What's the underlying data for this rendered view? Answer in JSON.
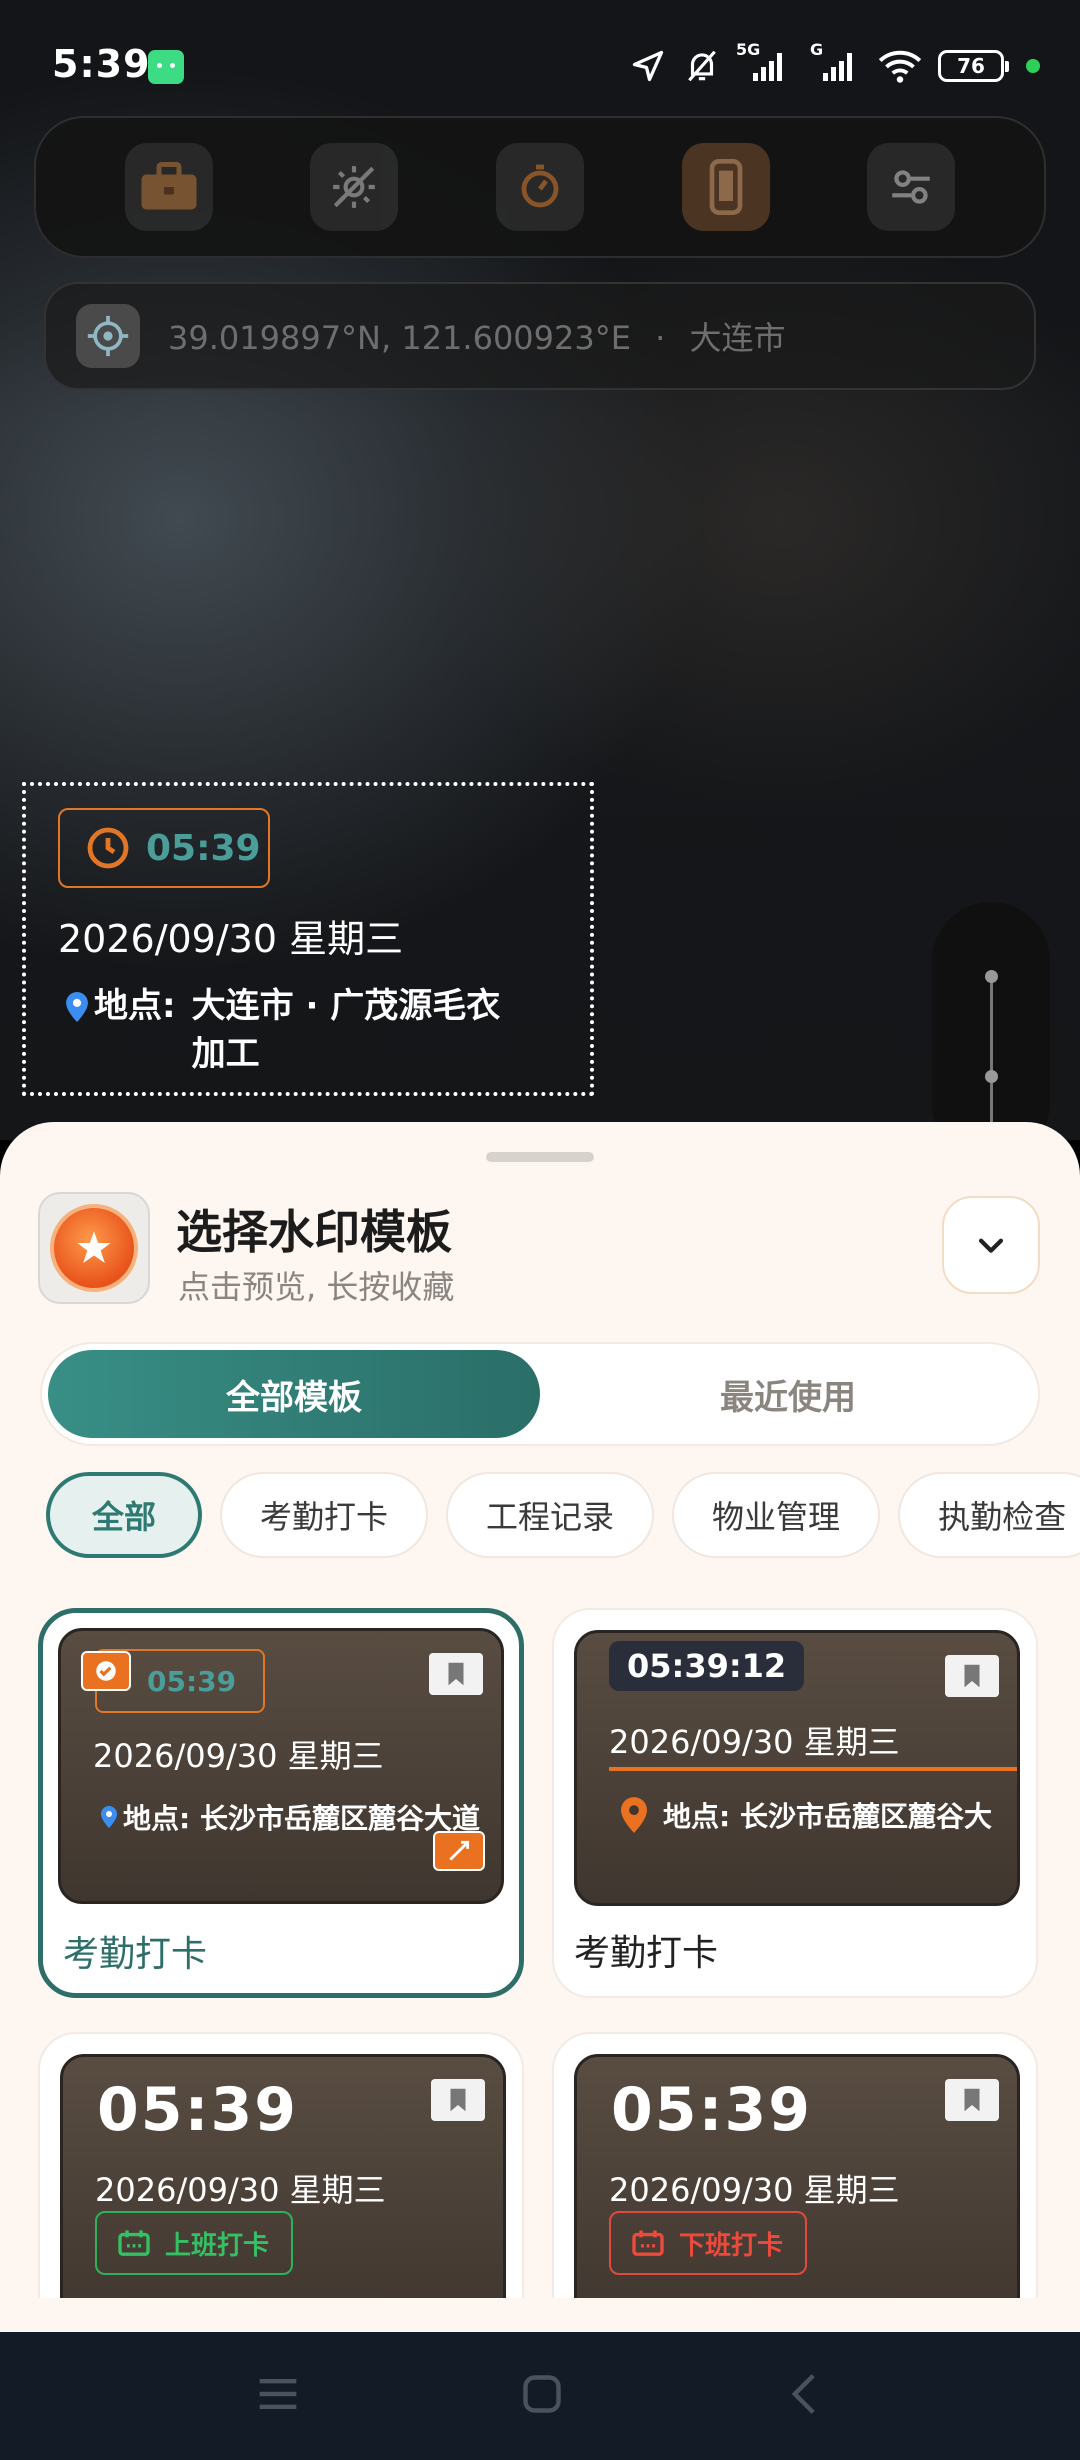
{
  "status_bar": {
    "time": "5:39",
    "network_label_1": "5G",
    "network_label_2": "G",
    "battery": "76",
    "icons": [
      "android-icon",
      "location-arrow-icon",
      "mute-bell-icon",
      "signal-5g-icon",
      "signal-icon",
      "wifi-icon",
      "battery-icon",
      "privacy-dot-icon"
    ]
  },
  "toolbar": {
    "items": [
      "briefcase-icon",
      "flash-off-icon",
      "timer-icon",
      "phone-frame-icon",
      "camera-settings-icon"
    ]
  },
  "location_bar": {
    "coords": "39.019897°N, 121.600923°E",
    "separator": "·",
    "city": "大连市"
  },
  "watermark_preview": {
    "time": "05:39",
    "date": "2026/09/30 星期三",
    "location_prefix": "地点:",
    "location_line1": "大连市 · 广茂源毛衣",
    "location_line2": "加工"
  },
  "sheet": {
    "title": "选择水印模板",
    "subtitle": "点击预览, 长按收藏",
    "segments": [
      "全部模板",
      "最近使用"
    ],
    "active_segment": "全部模板",
    "categories": [
      "全部",
      "考勤打卡",
      "工程记录",
      "物业管理",
      "执勤检查"
    ],
    "active_category": "全部",
    "templates": [
      {
        "label": "考勤打卡",
        "time": "05:39",
        "date": "2026/09/30 星期三",
        "location": "地点: 长沙市岳麓区麓谷大道",
        "selected": true
      },
      {
        "label": "考勤打卡",
        "time": "05:39:12",
        "date": "2026/09/30 星期三",
        "location": "地点: 长沙市岳麓区麓谷大",
        "selected": false
      },
      {
        "time": "05:39",
        "date": "2026/09/30 星期三",
        "badge": "上班打卡"
      },
      {
        "time": "05:39",
        "date": "2026/09/30 星期三",
        "badge": "下班打卡"
      }
    ]
  },
  "colors": {
    "accent": "#2e7a72",
    "orange": "#e07626",
    "clock_in_green": "#36c064",
    "clock_out_red": "#ee4a3c"
  },
  "nav_bar": {
    "icons": [
      "menu-icon",
      "home-icon",
      "back-icon"
    ]
  }
}
